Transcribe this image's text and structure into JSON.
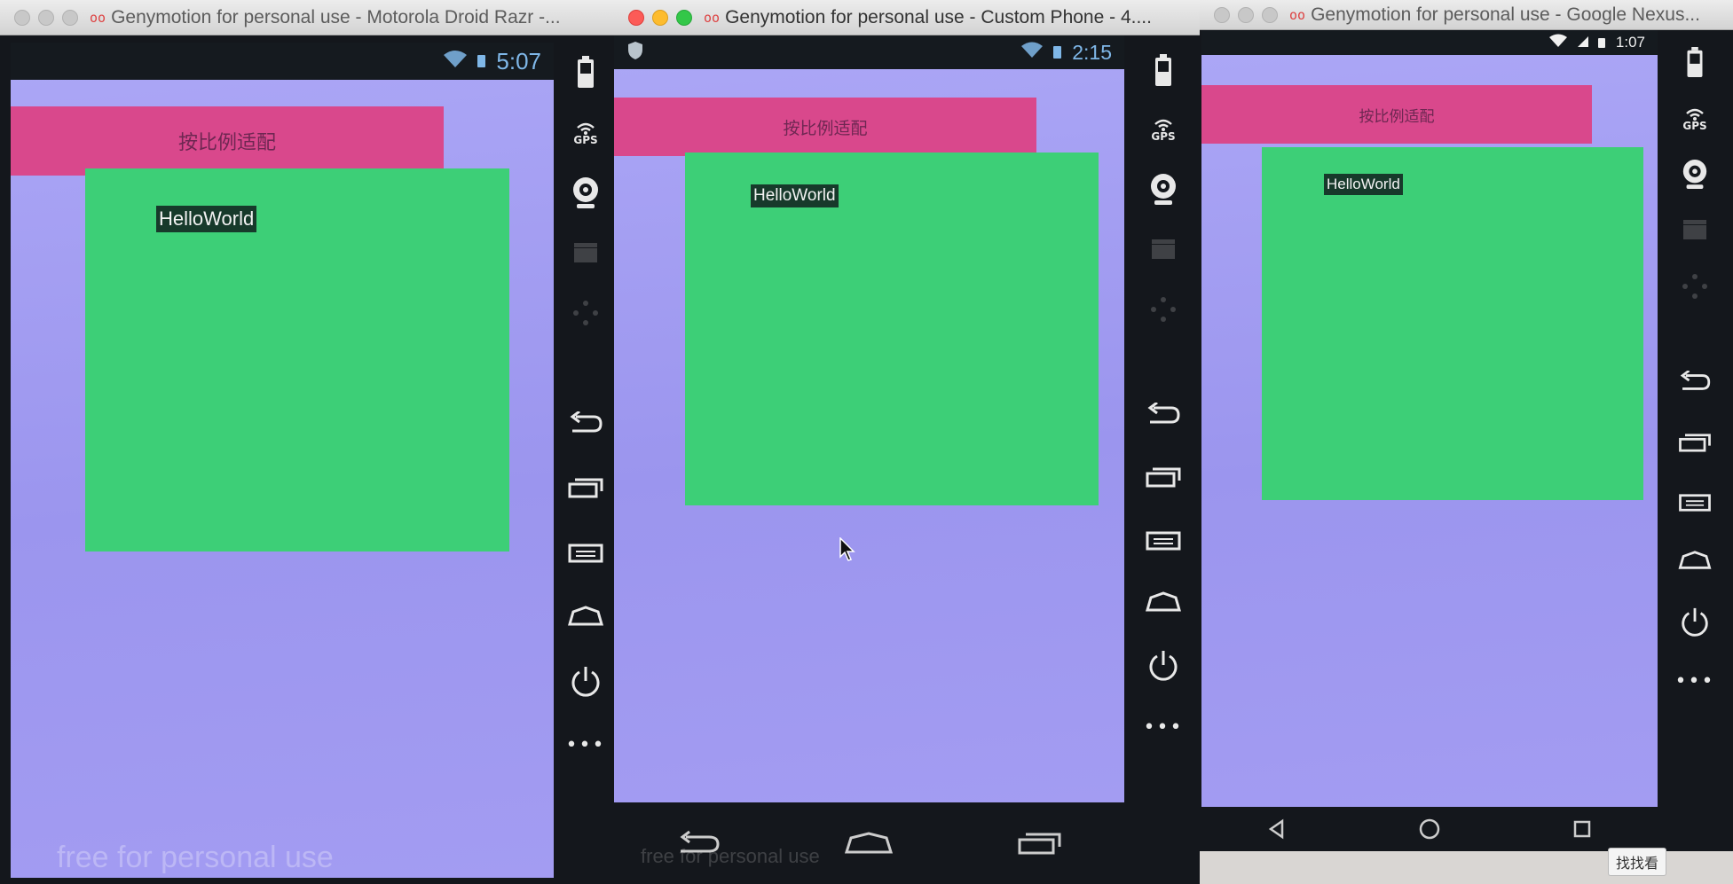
{
  "windows": [
    {
      "title": "Genymotion for personal use - Motorola Droid Razr -...",
      "logo": "oo",
      "active": false,
      "status_time": "5:07",
      "pink_label": "按比例适配",
      "hello_label": "HelloWorld",
      "watermark": "free for personal use"
    },
    {
      "title": "Genymotion for personal use - Custom Phone - 4....",
      "logo": "oo",
      "active": true,
      "status_time": "2:15",
      "pink_label": "按比例适配",
      "hello_label": "HelloWorld",
      "watermark": "free for personal use"
    },
    {
      "title": "Genymotion for personal use - Google Nexus...",
      "logo": "oo",
      "active": false,
      "status_time": "1:07",
      "pink_label": "按比例适配",
      "hello_label": "HelloWorld"
    }
  ],
  "sidebar": {
    "gps_label": "GPS",
    "more_label": "•••"
  },
  "find_button": "找找看",
  "colors": {
    "pink_bar": "#d9488c",
    "green_box": "#3dcf77",
    "screen_bg": "#a39cf2",
    "status_text": "#7fb7e8"
  }
}
